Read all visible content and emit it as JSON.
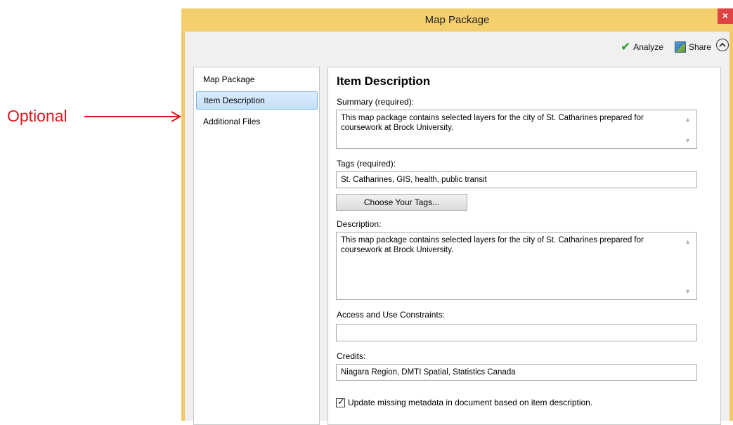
{
  "annotation": {
    "label": "Optional"
  },
  "window": {
    "title": "Map Package",
    "close_glyph": "×"
  },
  "toolbar": {
    "analyze_label": "Analyze",
    "share_label": "Share"
  },
  "nav": {
    "items": [
      {
        "label": "Map Package"
      },
      {
        "label": "Item Description"
      },
      {
        "label": "Additional Files"
      }
    ]
  },
  "content": {
    "title": "Item Description",
    "summary_label": "Summary (required):",
    "summary_value": "This map package contains selected layers for the city of St. Catharines prepared for coursework at Brock University.",
    "tags_label": "Tags (required):",
    "tags_value": "St. Catharines, GIS, health, public transit",
    "choose_tags_label": "Choose Your Tags...",
    "description_label": "Description:",
    "description_value": "This map package contains selected layers for the city of St. Catharines prepared for coursework at Brock University.",
    "access_label": "Access and Use Constraints:",
    "access_value": "",
    "credits_label": "Credits:",
    "credits_value": "Niagara Region, DMTI Spatial, Statistics Canada",
    "update_metadata_label": "Update missing metadata in document based on item description.",
    "update_metadata_checked": true
  },
  "colors": {
    "titlebar": "#f4cf6e",
    "annotation": "#e0191e",
    "selected_nav": "#c3e0fb",
    "close_button": "#e04343"
  }
}
